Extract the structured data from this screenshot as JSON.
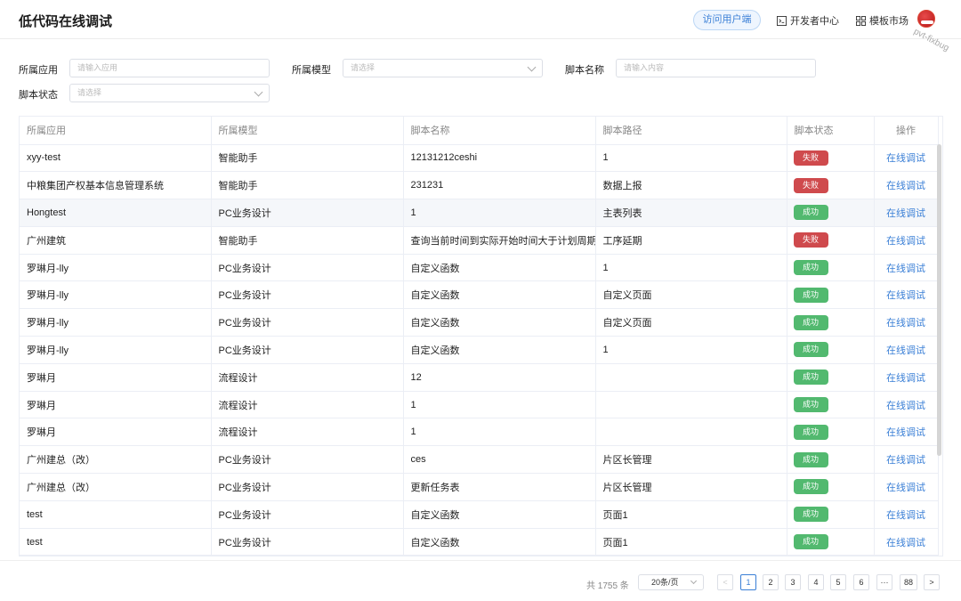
{
  "header": {
    "title": "低代码在线调试",
    "visit_btn": "访问用户端",
    "dev_center": "开发者中心",
    "template_market": "模板市场",
    "branch": "pvt-fixbug"
  },
  "filters": {
    "app_label": "所属应用",
    "app_placeholder": "请输入应用",
    "model_label": "所属模型",
    "model_placeholder": "请选择",
    "script_name_label": "脚本名称",
    "script_name_placeholder": "请输入内容",
    "status_label": "脚本状态",
    "status_placeholder": "请选择"
  },
  "table": {
    "columns": [
      "所属应用",
      "所属模型",
      "脚本名称",
      "脚本路径",
      "脚本状态",
      "操作"
    ],
    "action_label": "在线调试",
    "rows": [
      {
        "app": "xyy-test",
        "model": "智能助手",
        "name": "12131212ceshi",
        "path": "1",
        "status": "失败",
        "ok": false
      },
      {
        "app": "中粮集团产权基本信息管理系统",
        "model": "智能助手",
        "name": "231231",
        "path": "数据上报",
        "status": "失败",
        "ok": false
      },
      {
        "app": "Hongtest",
        "model": "PC业务设计",
        "name": "1",
        "path": "主表列表",
        "status": "成功",
        "ok": true
      },
      {
        "app": "广州建筑",
        "model": "智能助手",
        "name": "查询当前时间到实际开始时间大于计划周期",
        "path": "工序延期",
        "status": "失败",
        "ok": false
      },
      {
        "app": "罗琳月-lly",
        "model": "PC业务设计",
        "name": "自定义函数",
        "path": "1",
        "status": "成功",
        "ok": true
      },
      {
        "app": "罗琳月-lly",
        "model": "PC业务设计",
        "name": "自定义函数",
        "path": "自定义页面",
        "status": "成功",
        "ok": true
      },
      {
        "app": "罗琳月-lly",
        "model": "PC业务设计",
        "name": "自定义函数",
        "path": "自定义页面",
        "status": "成功",
        "ok": true
      },
      {
        "app": "罗琳月-lly",
        "model": "PC业务设计",
        "name": "自定义函数",
        "path": "1",
        "status": "成功",
        "ok": true
      },
      {
        "app": "罗琳月",
        "model": "流程设计",
        "name": "12",
        "path": "",
        "status": "成功",
        "ok": true
      },
      {
        "app": "罗琳月",
        "model": "流程设计",
        "name": "1",
        "path": "",
        "status": "成功",
        "ok": true
      },
      {
        "app": "罗琳月",
        "model": "流程设计",
        "name": "1",
        "path": "",
        "status": "成功",
        "ok": true
      },
      {
        "app": "广州建总（改）",
        "model": "PC业务设计",
        "name": "ces",
        "path": "片区长管理",
        "status": "成功",
        "ok": true
      },
      {
        "app": "广州建总（改）",
        "model": "PC业务设计",
        "name": "更新任务表",
        "path": "片区长管理",
        "status": "成功",
        "ok": true
      },
      {
        "app": "test",
        "model": "PC业务设计",
        "name": "自定义函数",
        "path": "页面1",
        "status": "成功",
        "ok": true
      },
      {
        "app": "test",
        "model": "PC业务设计",
        "name": "自定义函数",
        "path": "页面1",
        "status": "成功",
        "ok": true
      }
    ]
  },
  "pagination": {
    "total": "共 1755 条",
    "page_size": "20条/页",
    "prev": "<",
    "pages": [
      "1",
      "2",
      "3",
      "4",
      "5",
      "6"
    ],
    "ellipsis": "···",
    "last": "88",
    "next": ">",
    "current": "1"
  },
  "colors": {
    "primary": "#3a7fd6",
    "success": "#52b96f",
    "danger": "#cf4a4d"
  }
}
